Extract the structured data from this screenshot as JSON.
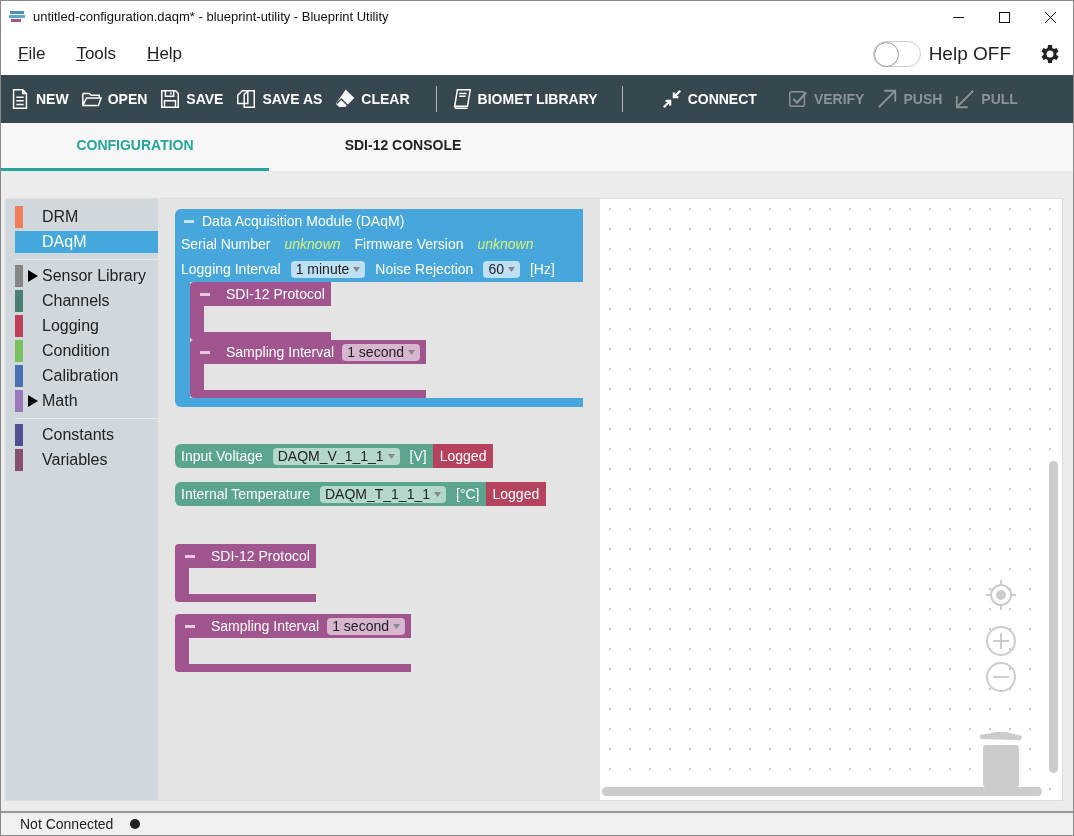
{
  "window": {
    "title": "untitled-configuration.daqm* - blueprint-utility - Blueprint Utility"
  },
  "menu": [
    {
      "mnemonic": "F",
      "rest": "ile"
    },
    {
      "mnemonic": "T",
      "rest": "ools"
    },
    {
      "mnemonic": "H",
      "rest": "elp"
    }
  ],
  "help_toggle": {
    "label": "Help OFF",
    "on": false
  },
  "toolbar": {
    "groups": [
      [
        {
          "kind": "new",
          "label": "NEW",
          "disabled": false
        },
        {
          "kind": "open",
          "label": "OPEN",
          "disabled": false
        },
        {
          "kind": "save",
          "label": "SAVE",
          "disabled": false
        },
        {
          "kind": "saveas",
          "label": "SAVE AS",
          "disabled": false
        },
        {
          "kind": "clear",
          "label": "CLEAR",
          "disabled": false
        }
      ],
      [
        {
          "kind": "library",
          "label": "BIOMET LIBRARY",
          "disabled": false
        }
      ],
      [
        {
          "kind": "connect",
          "label": "CONNECT",
          "disabled": false
        },
        {
          "kind": "verify",
          "label": "VERIFY",
          "disabled": true
        },
        {
          "kind": "push",
          "label": "PUSH",
          "disabled": true
        },
        {
          "kind": "pull",
          "label": "PULL",
          "disabled": true
        }
      ]
    ]
  },
  "tabs": [
    {
      "label": "CONFIGURATION",
      "selected": true
    },
    {
      "label": "SDI-12 CONSOLE",
      "selected": false
    }
  ],
  "sidebar": {
    "groups": [
      [
        {
          "label": "DRM",
          "color": "#f07c5c",
          "selected": false,
          "expandable": false
        },
        {
          "label": "DAqM",
          "color": "#45a8dc",
          "selected": true,
          "expandable": false
        }
      ],
      [
        {
          "label": "Sensor Library",
          "color": "#858585",
          "selected": false,
          "expandable": true
        },
        {
          "label": "Channels",
          "color": "#4b7f74",
          "selected": false,
          "expandable": false
        },
        {
          "label": "Logging",
          "color": "#c0405a",
          "selected": false,
          "expandable": false
        },
        {
          "label": "Condition",
          "color": "#78c060",
          "selected": false,
          "expandable": false
        },
        {
          "label": "Calibration",
          "color": "#4a6fb5",
          "selected": false,
          "expandable": false
        },
        {
          "label": "Math",
          "color": "#9b79b8",
          "selected": false,
          "expandable": true
        }
      ],
      [
        {
          "label": "Constants",
          "color": "#514f91",
          "selected": false,
          "expandable": false
        },
        {
          "label": "Variables",
          "color": "#87506e",
          "selected": false,
          "expandable": false
        }
      ]
    ]
  },
  "flyout": {
    "module": {
      "title": "Data Acquisition Module (DAqM)",
      "serial_label": "Serial Number",
      "serial_value": "unknown",
      "firmware_label": "Firmware Version",
      "firmware_value": "unknown",
      "interval_label": "Logging Interval",
      "interval_value": "1 minute",
      "noise_label": "Noise Rejection",
      "noise_value": "60",
      "noise_unit": "[Hz]",
      "children": [
        {
          "title": "SDI-12 Protocol"
        },
        {
          "title": "Sampling Interval",
          "value": "1 second"
        }
      ]
    },
    "channels": [
      {
        "label": "Input Voltage",
        "value": "DAQM_V_1_1_1",
        "unit": "[V]",
        "logged": "Logged"
      },
      {
        "label": "Internal Temperature",
        "value": "DAQM_T_1_1_1",
        "unit": "[°C]",
        "logged": "Logged"
      }
    ],
    "statements": [
      {
        "title": "SDI-12 Protocol"
      },
      {
        "title": "Sampling Interval",
        "value": "1 second"
      }
    ]
  },
  "status_bar": {
    "text": "Not Connected",
    "connected": false
  }
}
